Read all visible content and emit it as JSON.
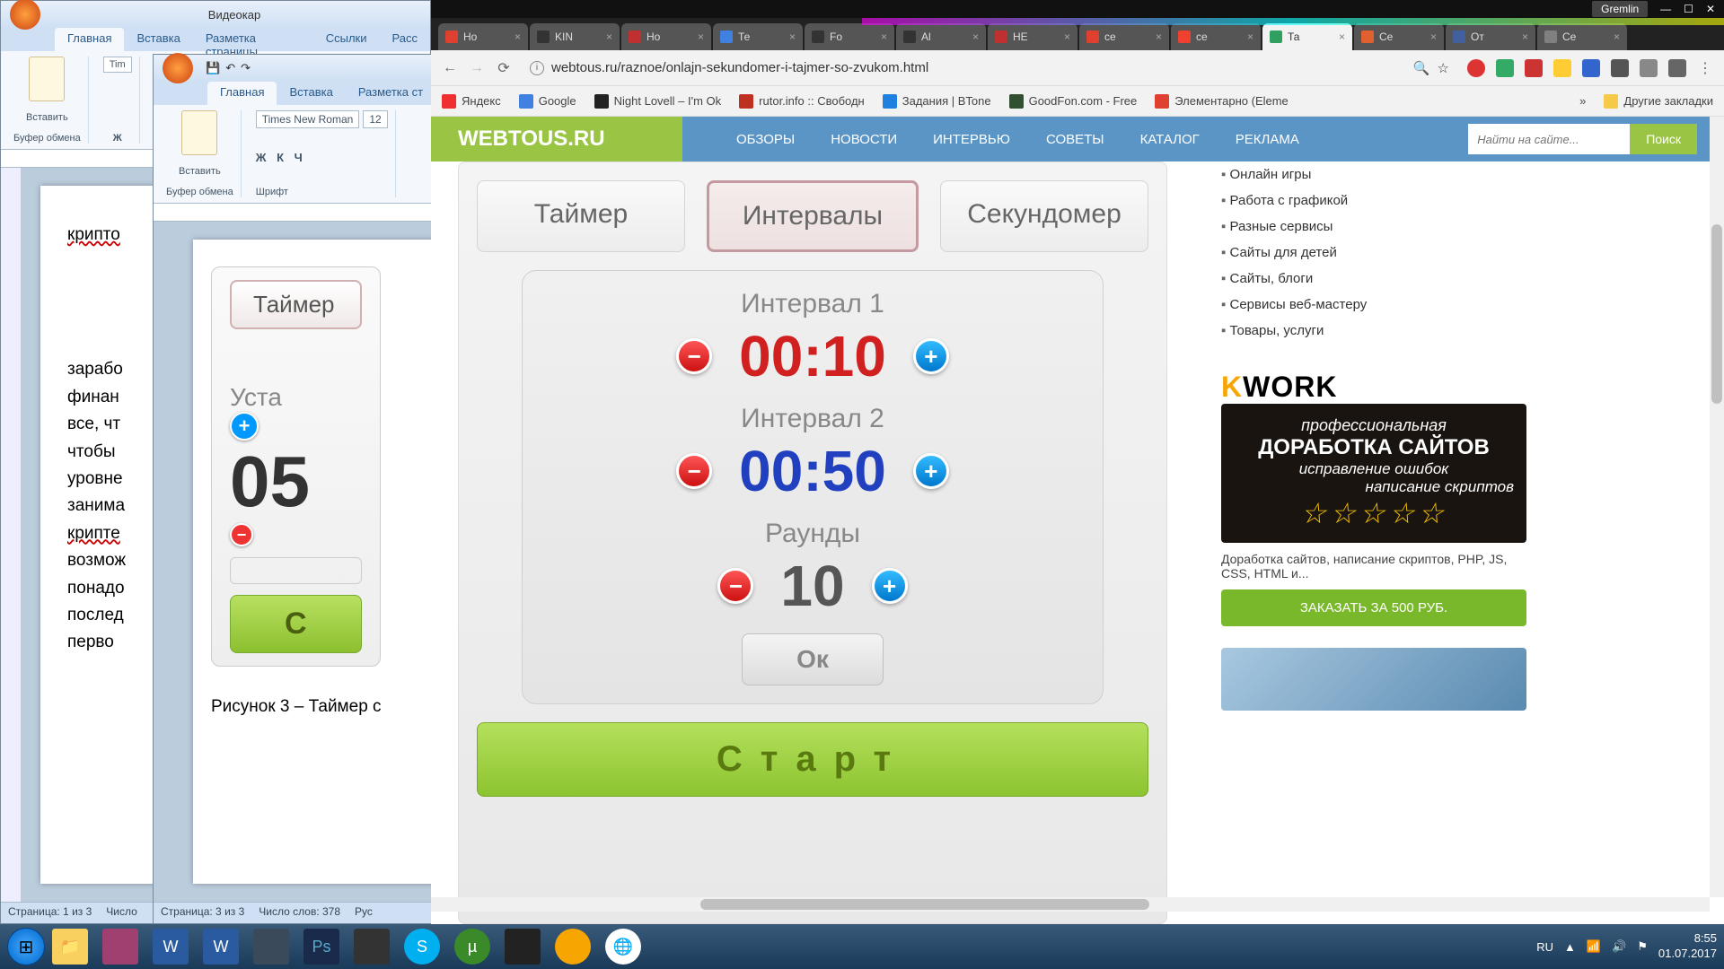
{
  "taskbar": {
    "lang": "RU",
    "time": "8:55",
    "date": "01.07.2017"
  },
  "chrome_top": {
    "user": "Gremlin"
  },
  "word1": {
    "title": "Видеокар",
    "tabs": [
      "Главная",
      "Вставка",
      "Разметка страницы",
      "Ссылки",
      "Расс"
    ],
    "clipboard_label": "Вставить",
    "clipboard_group": "Буфер обмена",
    "font_family": "Tim",
    "bold": "Ж",
    "text": "крипто",
    "lines": [
      "зарабо",
      "финан",
      "все, чт",
      "чтобы",
      "уровне",
      "занима",
      "крипте",
      "возмож",
      "понадо",
      "послед",
      "перво"
    ],
    "status_page": "Страница: 1 из 3",
    "status_words": "Число"
  },
  "word2": {
    "tabs": [
      "Главная",
      "Вставка",
      "Разметка ст"
    ],
    "clipboard_label": "Вставить",
    "clipboard_group": "Буфер обмена",
    "font_group": "Шрифт",
    "font_family": "Times New Roman",
    "font_size": "12",
    "format_btns": "Ж  К  Ч",
    "timer_tab": "Таймер",
    "set_label": "Уста",
    "big_time": "05",
    "caption": "Рисунок 3 – Таймер с",
    "start": "С",
    "status_page": "Страница: 3 из 3",
    "status_words": "Число слов: 378",
    "status_lang": "Рус"
  },
  "chrome": {
    "tabs": [
      {
        "label": "Но",
        "fav": "#e04030"
      },
      {
        "label": "KIN",
        "fav": "#333"
      },
      {
        "label": "Но",
        "fav": "#c03030"
      },
      {
        "label": "Те",
        "fav": "#4080e0"
      },
      {
        "label": "Fo",
        "fav": "#333"
      },
      {
        "label": "Al",
        "fav": "#333"
      },
      {
        "label": "HE",
        "fav": "#c03030"
      },
      {
        "label": "се",
        "fav": "#e04030"
      },
      {
        "label": "се",
        "fav": "#f04030"
      },
      {
        "label": "Та",
        "fav": "#30a060",
        "active": true
      },
      {
        "label": "Се",
        "fav": "#e06030"
      },
      {
        "label": "От",
        "fav": "#4060a0"
      },
      {
        "label": "Се",
        "fav": "#808080"
      }
    ],
    "url": "webtous.ru/raznoe/onlajn-sekundomer-i-tajmer-so-zvukom.html",
    "bookmarks": [
      {
        "label": "Яндекс",
        "color": "#f03030"
      },
      {
        "label": "Google",
        "color": "#4080e0"
      },
      {
        "label": "Night Lovell – I'm Ok",
        "color": "#222"
      },
      {
        "label": "rutor.info :: Свободн",
        "color": "#c03020"
      },
      {
        "label": "Задания | BTone",
        "color": "#2080e0"
      },
      {
        "label": "GoodFon.com - Free",
        "color": "#305030"
      },
      {
        "label": "Элементарно (Eleme",
        "color": "#e04030"
      }
    ],
    "bm_more": "»",
    "bm_other": "Другие закладки"
  },
  "site": {
    "logo": "WEBTOUS.RU",
    "nav": [
      "ОБЗОРЫ",
      "НОВОСТИ",
      "ИНТЕРВЬЮ",
      "СОВЕТЫ",
      "КАТАЛОГ",
      "РЕКЛАМА"
    ],
    "search_placeholder": "Найти на сайте...",
    "search_btn": "Поиск",
    "timer": {
      "tabs": [
        "Таймер",
        "Интервалы",
        "Секундомер"
      ],
      "interval1_label": "Интервал 1",
      "interval1_val": "00:10",
      "interval2_label": "Интервал 2",
      "interval2_val": "00:50",
      "rounds_label": "Раунды",
      "rounds_val": "10",
      "ok": "Ок",
      "start": "Старт"
    },
    "sidebar": {
      "items": [
        "Онлайн игры",
        "Работа с графикой",
        "Разные сервисы",
        "Сайты для детей",
        "Сайты, блоги",
        "Сервисы веб-мастеру",
        "Товары, услуги"
      ]
    },
    "kwork": {
      "logo_text": "KWORK",
      "l1": "профессиональная",
      "l2": "ДОРАБОТКА САЙТОВ",
      "l3": "исправление ошибок",
      "l4": "написание скриптов",
      "stars": "☆☆☆☆☆",
      "desc": "Доработка сайтов, написание скриптов, PHP, JS, CSS, HTML и...",
      "btn": "ЗАКАЗАТЬ ЗА 500 РУБ."
    }
  }
}
